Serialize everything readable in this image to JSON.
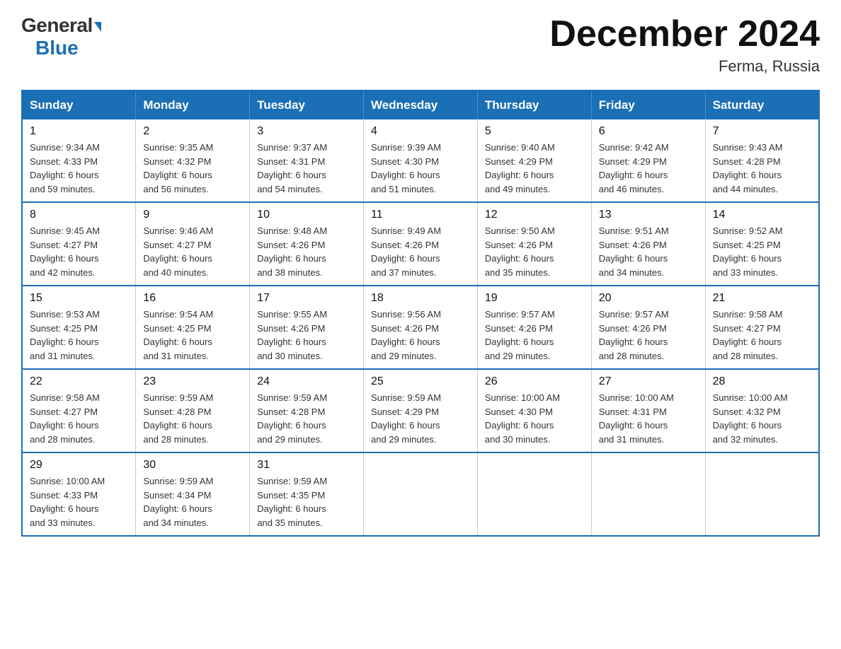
{
  "logo": {
    "general": "General",
    "blue": "Blue"
  },
  "title": {
    "month": "December 2024",
    "location": "Ferma, Russia"
  },
  "weekdays": [
    "Sunday",
    "Monday",
    "Tuesday",
    "Wednesday",
    "Thursday",
    "Friday",
    "Saturday"
  ],
  "weeks": [
    [
      {
        "day": "1",
        "sunrise": "9:34 AM",
        "sunset": "4:33 PM",
        "daylight": "6 hours and 59 minutes."
      },
      {
        "day": "2",
        "sunrise": "9:35 AM",
        "sunset": "4:32 PM",
        "daylight": "6 hours and 56 minutes."
      },
      {
        "day": "3",
        "sunrise": "9:37 AM",
        "sunset": "4:31 PM",
        "daylight": "6 hours and 54 minutes."
      },
      {
        "day": "4",
        "sunrise": "9:39 AM",
        "sunset": "4:30 PM",
        "daylight": "6 hours and 51 minutes."
      },
      {
        "day": "5",
        "sunrise": "9:40 AM",
        "sunset": "4:29 PM",
        "daylight": "6 hours and 49 minutes."
      },
      {
        "day": "6",
        "sunrise": "9:42 AM",
        "sunset": "4:29 PM",
        "daylight": "6 hours and 46 minutes."
      },
      {
        "day": "7",
        "sunrise": "9:43 AM",
        "sunset": "4:28 PM",
        "daylight": "6 hours and 44 minutes."
      }
    ],
    [
      {
        "day": "8",
        "sunrise": "9:45 AM",
        "sunset": "4:27 PM",
        "daylight": "6 hours and 42 minutes."
      },
      {
        "day": "9",
        "sunrise": "9:46 AM",
        "sunset": "4:27 PM",
        "daylight": "6 hours and 40 minutes."
      },
      {
        "day": "10",
        "sunrise": "9:48 AM",
        "sunset": "4:26 PM",
        "daylight": "6 hours and 38 minutes."
      },
      {
        "day": "11",
        "sunrise": "9:49 AM",
        "sunset": "4:26 PM",
        "daylight": "6 hours and 37 minutes."
      },
      {
        "day": "12",
        "sunrise": "9:50 AM",
        "sunset": "4:26 PM",
        "daylight": "6 hours and 35 minutes."
      },
      {
        "day": "13",
        "sunrise": "9:51 AM",
        "sunset": "4:26 PM",
        "daylight": "6 hours and 34 minutes."
      },
      {
        "day": "14",
        "sunrise": "9:52 AM",
        "sunset": "4:25 PM",
        "daylight": "6 hours and 33 minutes."
      }
    ],
    [
      {
        "day": "15",
        "sunrise": "9:53 AM",
        "sunset": "4:25 PM",
        "daylight": "6 hours and 31 minutes."
      },
      {
        "day": "16",
        "sunrise": "9:54 AM",
        "sunset": "4:25 PM",
        "daylight": "6 hours and 31 minutes."
      },
      {
        "day": "17",
        "sunrise": "9:55 AM",
        "sunset": "4:26 PM",
        "daylight": "6 hours and 30 minutes."
      },
      {
        "day": "18",
        "sunrise": "9:56 AM",
        "sunset": "4:26 PM",
        "daylight": "6 hours and 29 minutes."
      },
      {
        "day": "19",
        "sunrise": "9:57 AM",
        "sunset": "4:26 PM",
        "daylight": "6 hours and 29 minutes."
      },
      {
        "day": "20",
        "sunrise": "9:57 AM",
        "sunset": "4:26 PM",
        "daylight": "6 hours and 28 minutes."
      },
      {
        "day": "21",
        "sunrise": "9:58 AM",
        "sunset": "4:27 PM",
        "daylight": "6 hours and 28 minutes."
      }
    ],
    [
      {
        "day": "22",
        "sunrise": "9:58 AM",
        "sunset": "4:27 PM",
        "daylight": "6 hours and 28 minutes."
      },
      {
        "day": "23",
        "sunrise": "9:59 AM",
        "sunset": "4:28 PM",
        "daylight": "6 hours and 28 minutes."
      },
      {
        "day": "24",
        "sunrise": "9:59 AM",
        "sunset": "4:28 PM",
        "daylight": "6 hours and 29 minutes."
      },
      {
        "day": "25",
        "sunrise": "9:59 AM",
        "sunset": "4:29 PM",
        "daylight": "6 hours and 29 minutes."
      },
      {
        "day": "26",
        "sunrise": "10:00 AM",
        "sunset": "4:30 PM",
        "daylight": "6 hours and 30 minutes."
      },
      {
        "day": "27",
        "sunrise": "10:00 AM",
        "sunset": "4:31 PM",
        "daylight": "6 hours and 31 minutes."
      },
      {
        "day": "28",
        "sunrise": "10:00 AM",
        "sunset": "4:32 PM",
        "daylight": "6 hours and 32 minutes."
      }
    ],
    [
      {
        "day": "29",
        "sunrise": "10:00 AM",
        "sunset": "4:33 PM",
        "daylight": "6 hours and 33 minutes."
      },
      {
        "day": "30",
        "sunrise": "9:59 AM",
        "sunset": "4:34 PM",
        "daylight": "6 hours and 34 minutes."
      },
      {
        "day": "31",
        "sunrise": "9:59 AM",
        "sunset": "4:35 PM",
        "daylight": "6 hours and 35 minutes."
      },
      null,
      null,
      null,
      null
    ]
  ],
  "labels": {
    "sunrise": "Sunrise:",
    "sunset": "Sunset:",
    "daylight": "Daylight:"
  }
}
